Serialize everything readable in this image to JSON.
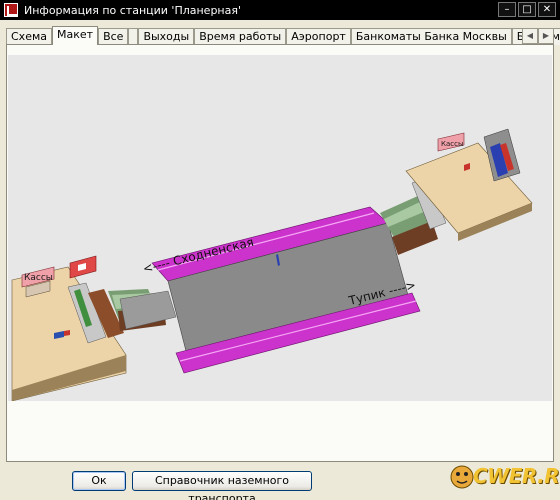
{
  "window": {
    "title": "Информация по станции 'Планерная'"
  },
  "tabs": [
    "Схема",
    "Макет",
    "Все",
    "",
    "Выходы",
    "Время работы",
    "Аэропорт",
    "Банкоматы Банка Москвы",
    "Банкоматы"
  ],
  "active_tab": "Макет",
  "scene": {
    "direction_left": "<---- Сходненская",
    "direction_right": "Тупик ---->",
    "kassy_label": "Кассы",
    "kassy_label_right": "Кассы",
    "colors": {
      "platform": "#808080",
      "track": "#cc33cc",
      "hall": "#ecd4a8"
    }
  },
  "buttons": {
    "ok": "Ок",
    "ground_transport": "Справочник наземного транспорта"
  },
  "logo": {
    "text": "CWER.RU"
  }
}
